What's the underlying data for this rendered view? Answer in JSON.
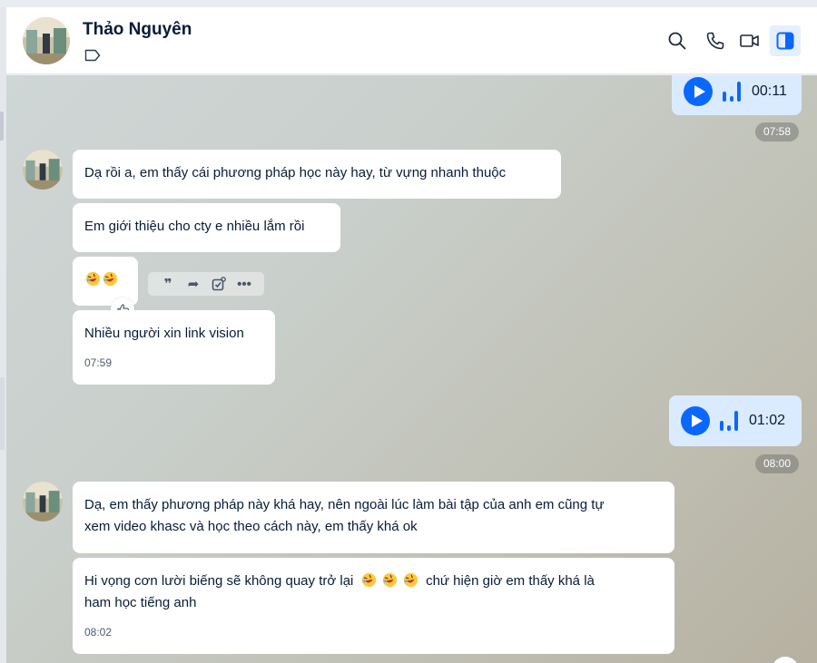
{
  "header": {
    "name": "Thảo Nguyên",
    "icons": [
      "tag-icon",
      "search-icon",
      "phone-icon",
      "video-icon",
      "sidebar-toggle-icon"
    ]
  },
  "colors": {
    "accent": "#0a68ff",
    "own_bubble": "#dbebff",
    "other_bubble": "#ffffff"
  },
  "messages": {
    "voice1": {
      "duration": "00:11",
      "stamp": "07:58"
    },
    "m1": "Dạ rồi a, em thấy cái phương pháp học này hay, từ vựng nhanh thuộc",
    "m2": "Em giới thiệu cho cty e nhiều lắm rồi",
    "m3_emoji": [
      "rofl-emoji",
      "rofl-emoji"
    ],
    "m4": {
      "text": "Nhiều người xin link vision",
      "time": "07:59"
    },
    "voice2": {
      "duration": "01:02",
      "stamp": "08:00"
    },
    "m5_line1": "Dạ, em thấy phương pháp này khá hay, nên ngoài lúc làm bài tập của anh em cũng tự",
    "m5_line2": "xem video khasc và học theo cách này, em thấy khá ok",
    "m6": {
      "line1_before": "Hi vọng cơn lười biếng sẽ không quay trở lại",
      "line1_after": "chứ hiện giờ em thấy khá là",
      "line2": "ham học tiếng anh",
      "time": "08:02"
    }
  },
  "message_actions": [
    "quote-icon",
    "forward-icon",
    "add-task-icon",
    "more-icon"
  ]
}
